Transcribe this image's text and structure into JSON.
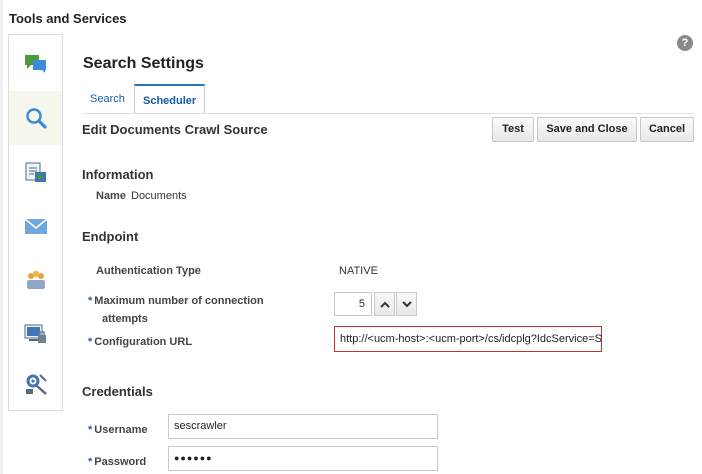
{
  "app": {
    "title": "Tools and Services",
    "help_label": "?"
  },
  "sidebar": {
    "items": [
      {
        "icon": "chat-bubbles-icon",
        "active": false
      },
      {
        "icon": "search-icon",
        "active": true
      },
      {
        "icon": "document-arrow-icon",
        "active": false
      },
      {
        "icon": "envelope-icon",
        "active": false
      },
      {
        "icon": "people-icon",
        "active": false
      },
      {
        "icon": "screen-lock-icon",
        "active": false
      },
      {
        "icon": "tools-gear-icon",
        "active": false
      }
    ]
  },
  "page": {
    "title": "Search Settings",
    "tabs": [
      {
        "label": "Search",
        "selected": false
      },
      {
        "label": "Scheduler",
        "selected": true
      }
    ]
  },
  "form": {
    "title": "Edit Documents Crawl Source",
    "buttons": {
      "test": "Test",
      "save_close": "Save and Close",
      "cancel": "Cancel"
    },
    "information": {
      "heading": "Information",
      "name_label": "Name",
      "name_value": "Documents"
    },
    "endpoint": {
      "heading": "Endpoint",
      "auth_type_label": "Authentication Type",
      "auth_type_value": "NATIVE",
      "required_mark": "*",
      "max_conn_label_line1": "Maximum number of connection",
      "max_conn_label_line2": "attempts",
      "max_conn_value": "5",
      "config_url_label": "Configuration URL",
      "config_url_value": "http://<ucm-host>:<ucm-port>/cs/idcplg?IdcService=S"
    },
    "credentials": {
      "heading": "Credentials",
      "username_label": "Username",
      "username_value": "sescrawler",
      "password_label": "Password",
      "password_value": "●●●●●●"
    }
  },
  "colors": {
    "accent": "#2a74b8",
    "link": "#145c9e",
    "error_border": "#c8302a"
  }
}
